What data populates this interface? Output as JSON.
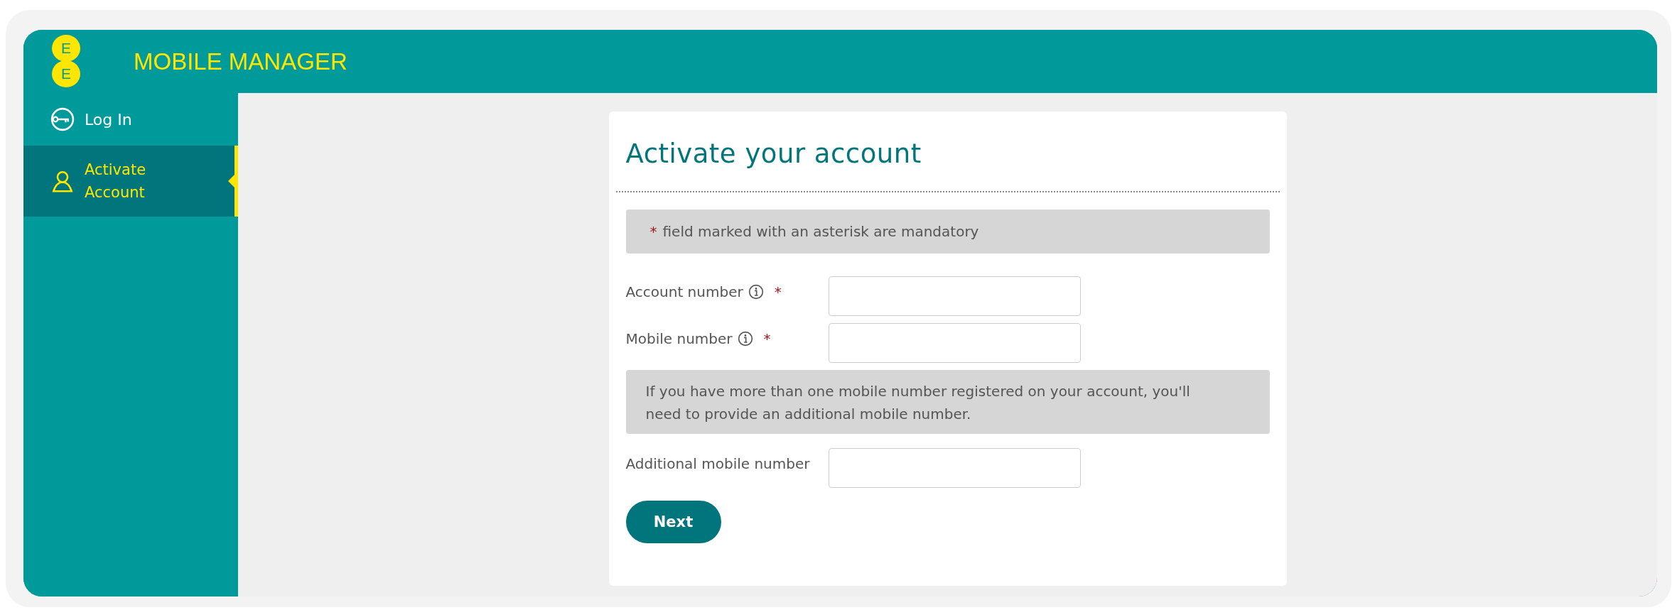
{
  "header": {
    "logo_letters": [
      "E",
      "E"
    ],
    "title": "MOBILE MANAGER"
  },
  "sidebar": {
    "items": [
      {
        "label": "Log In",
        "selected": false
      },
      {
        "label": "Activate Account",
        "selected": true
      }
    ]
  },
  "form": {
    "title": "Activate your account",
    "notice": {
      "asterisk": "*",
      "text": "field marked with an asterisk are mandatory"
    },
    "fields": [
      {
        "kind": "field",
        "label": "Account number",
        "info": true,
        "required": true,
        "asterisk": "*"
      },
      {
        "kind": "field",
        "label": "Mobile number",
        "info": true,
        "required": true,
        "asterisk": "*"
      },
      {
        "kind": "note",
        "text": "If you have more than one mobile number registered on your account, you'll need to provide an additional mobile number."
      },
      {
        "kind": "field",
        "label": "Additional mobile number",
        "info": false,
        "required": false
      }
    ],
    "button": "Next"
  }
}
